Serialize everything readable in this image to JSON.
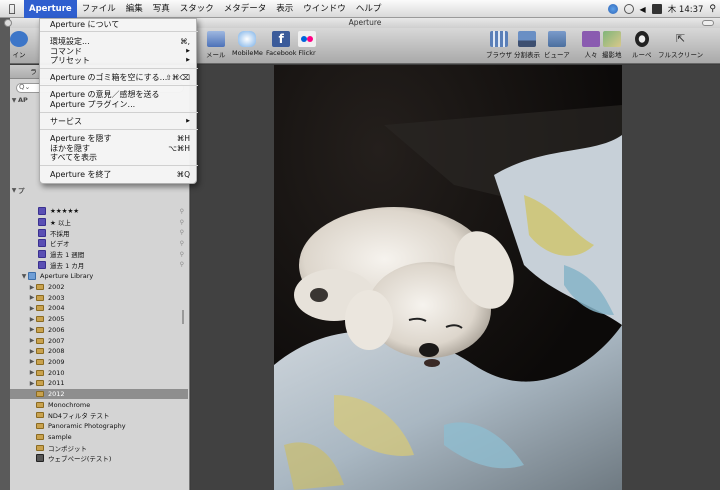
{
  "menubar": {
    "apple_icon": "apple-icon",
    "menus": [
      "Aperture",
      "ファイル",
      "編集",
      "写真",
      "スタック",
      "メタデータ",
      "表示",
      "ウインドウ",
      "ヘルプ"
    ],
    "clock": "木 14:37"
  },
  "window": {
    "title": "Aperture"
  },
  "toolbar": {
    "left_label": "イン",
    "share": [
      "メール",
      "MobileMe",
      "Facebook",
      "Flickr"
    ],
    "views": [
      "ブラウザ",
      "分割表示",
      "ビューア"
    ],
    "right": [
      "人々",
      "撮影地",
      "ルーペ",
      "フルスクリーン"
    ]
  },
  "sidebar": {
    "tab_partial": "ラ",
    "lib_partial": "AP",
    "smart_partial": "プ",
    "smart_items": [
      "★★★★★",
      "★ 以上",
      "不採用",
      "ビデオ",
      "過去 1 週間",
      "過去 1 カ月"
    ],
    "library": "Aperture Library",
    "years": [
      "2002",
      "2003",
      "2004",
      "2005",
      "2006",
      "2007",
      "2008",
      "2009",
      "2010",
      "2011",
      "2012"
    ],
    "albums": [
      "Monochrome",
      "ND4フィルタ テスト",
      "Panoramic Photography",
      "sample",
      "コンポジット"
    ],
    "web": "ウェブページ(テスト)"
  },
  "app_menu": {
    "items": [
      {
        "label": "Aperture について",
        "shortcut": ""
      },
      {
        "label": "環境設定...",
        "shortcut": "⌘,"
      },
      {
        "label": "コマンド",
        "shortcut": "▶"
      },
      {
        "label": "プリセット",
        "shortcut": "▶"
      },
      {
        "label": "Aperture のゴミ箱を空にする...",
        "shortcut": "⇧⌘⌫"
      },
      {
        "label": "Aperture の意見／感想を送る",
        "shortcut": ""
      },
      {
        "label": "Aperture プラグイン...",
        "shortcut": ""
      },
      {
        "label": "サービス",
        "shortcut": "▶"
      },
      {
        "label": "Aperture を隠す",
        "shortcut": "⌘H"
      },
      {
        "label": "ほかを隠す",
        "shortcut": "⌥⌘H"
      },
      {
        "label": "すべてを表示",
        "shortcut": ""
      },
      {
        "label": "Aperture を終了",
        "shortcut": "⌘Q"
      }
    ]
  }
}
